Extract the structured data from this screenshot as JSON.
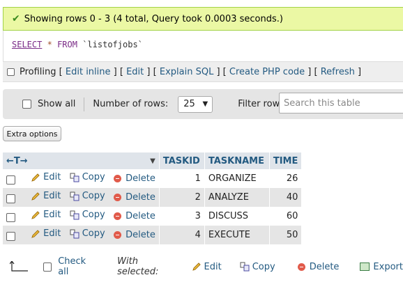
{
  "success_message": "Showing rows 0 - 3 (4 total, Query took 0.0003 seconds.)",
  "query": {
    "select": "SELECT",
    "star": "*",
    "from": "FROM",
    "table": "`listofjobs`"
  },
  "query_links": {
    "profiling": "Profiling",
    "edit_inline": "Edit inline",
    "edit": "Edit",
    "explain_sql": "Explain SQL",
    "create_php": "Create PHP code",
    "refresh": "Refresh",
    "open_bracket": "[",
    "close_bracket": "]"
  },
  "nav": {
    "show_all": "Show all",
    "number_of_rows_label": "Number of rows:",
    "rows_value": "25",
    "filter_label": "Filter rows:",
    "search_placeholder": "Search this table"
  },
  "extra_options": "Extra options",
  "table": {
    "columns": [
      "TASKID",
      "TASKNAME",
      "TIME"
    ],
    "actions": {
      "edit": "Edit",
      "copy": "Copy",
      "delete": "Delete"
    },
    "rows": [
      {
        "taskid": "1",
        "taskname": "ORGANIZE",
        "time": "26"
      },
      {
        "taskid": "2",
        "taskname": "ANALYZE",
        "time": "40"
      },
      {
        "taskid": "3",
        "taskname": "DISCUSS",
        "time": "60"
      },
      {
        "taskid": "4",
        "taskname": "EXECUTE",
        "time": "50"
      }
    ]
  },
  "bottom": {
    "check_all": "Check all",
    "with_selected": "With selected:",
    "edit": "Edit",
    "copy": "Copy",
    "delete": "Delete",
    "export": "Export"
  },
  "colors": {
    "success_bg": "#ebf8a4",
    "link": "#235a81",
    "header_bg": "#dfe4ea",
    "row_alt": "#e5e5e5",
    "delete_icon": "#e15a4a"
  }
}
